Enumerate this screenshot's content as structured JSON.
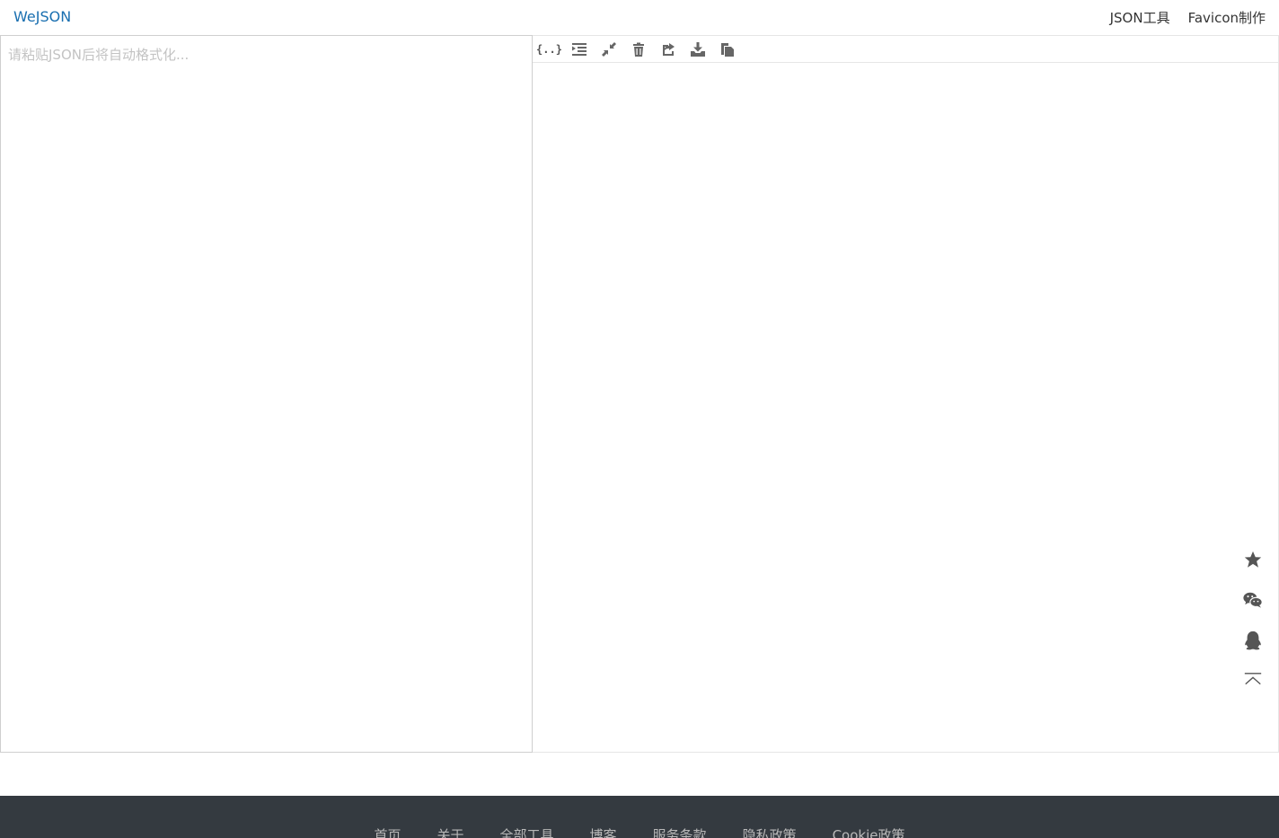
{
  "header": {
    "brand": "WeJSON",
    "nav": [
      "JSON工具",
      "Favicon制作"
    ]
  },
  "editor": {
    "placeholder": "请粘贴JSON后将自动格式化..."
  },
  "toolbar": {
    "buttons": [
      {
        "icon": "braces-icon",
        "glyph": "{..}"
      },
      {
        "icon": "indent-icon"
      },
      {
        "icon": "compress-icon"
      },
      {
        "icon": "trash-icon"
      },
      {
        "icon": "share-icon"
      },
      {
        "icon": "download-icon"
      },
      {
        "icon": "copy-icon"
      }
    ]
  },
  "floating": [
    "star-icon",
    "wechat-icon",
    "qq-icon",
    "back-to-top-icon"
  ],
  "footer": {
    "links": [
      "首页",
      "关于",
      "全部工具",
      "博客",
      "服务条款",
      "隐私政策",
      "Cookie政策"
    ]
  },
  "colors": {
    "brand": "#1a6fb0",
    "footer_bg": "#343a40",
    "footer_text": "#b8b8b8"
  }
}
